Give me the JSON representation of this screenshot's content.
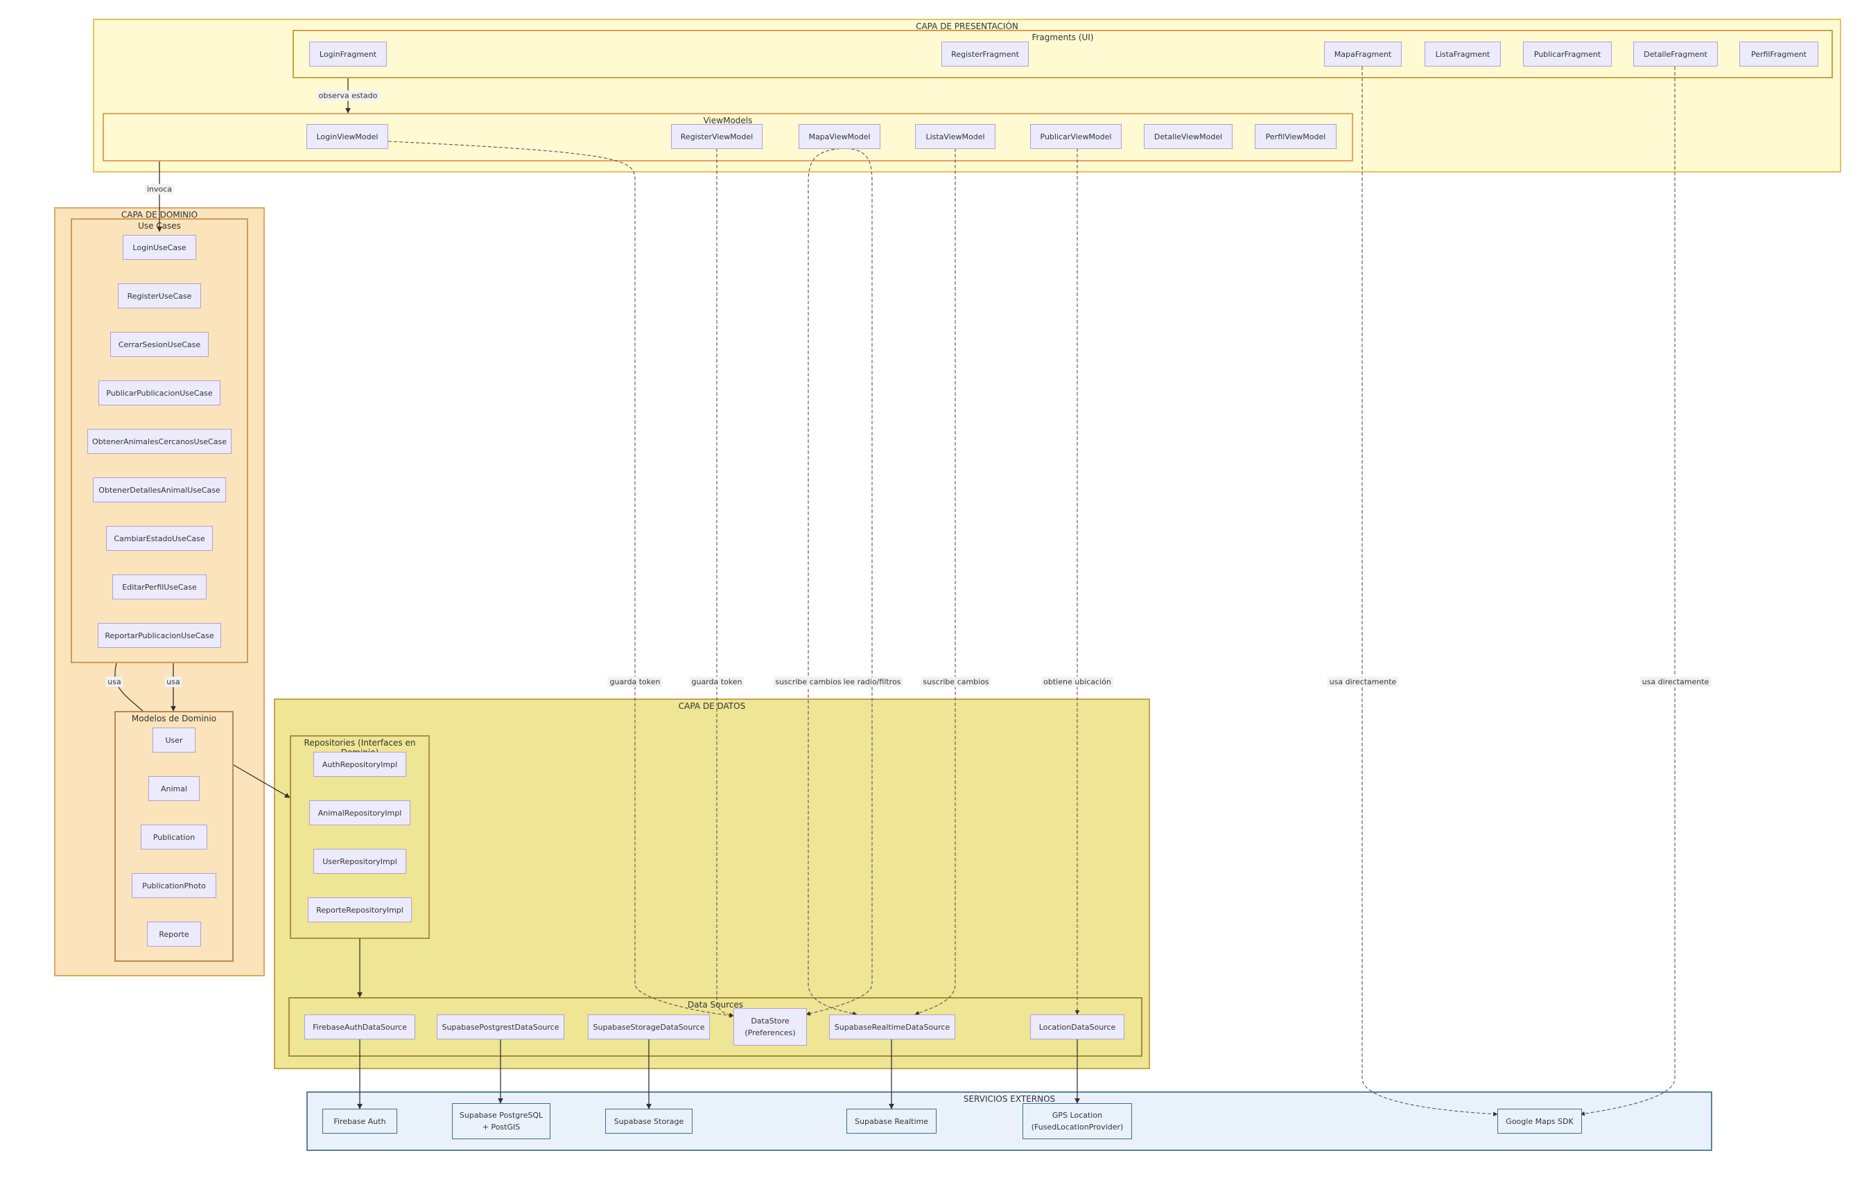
{
  "groups": {
    "presentacion": "CAPA DE PRESENTACIÓN",
    "fragments": "Fragments (UI)",
    "viewmodels": "ViewModels",
    "dominio": "CAPA DE DOMINIO",
    "usecases": "Use Cases",
    "modelos": "Modelos de Dominio",
    "datos": "CAPA DE DATOS",
    "repos": "Repositories (Interfaces en Dominio)",
    "datasources": "Data Sources",
    "externos": "SERVICIOS EXTERNOS"
  },
  "fragments": [
    "LoginFragment",
    "RegisterFragment",
    "MapaFragment",
    "ListaFragment",
    "PublicarFragment",
    "DetalleFragment",
    "PerfilFragment"
  ],
  "viewmodels": [
    "LoginViewModel",
    "RegisterViewModel",
    "MapaViewModel",
    "ListaViewModel",
    "PublicarViewModel",
    "DetalleViewModel",
    "PerfilViewModel"
  ],
  "usecases": [
    "LoginUseCase",
    "RegisterUseCase",
    "CerrarSesionUseCase",
    "PublicarPublicacionUseCase",
    "ObtenerAnimalesCercanosUseCase",
    "ObtenerDetallesAnimalUseCase",
    "CambiarEstadoUseCase",
    "EditarPerfilUseCase",
    "ReportarPublicacionUseCase"
  ],
  "modelos": [
    "User",
    "Animal",
    "Publication",
    "PublicationPhoto",
    "Reporte"
  ],
  "repos": [
    "AuthRepositoryImpl",
    "AnimalRepositoryImpl",
    "UserRepositoryImpl",
    "ReporteRepositoryImpl"
  ],
  "datasources": [
    "FirebaseAuthDataSource",
    "SupabasePostgrestDataSource",
    "SupabaseStorageDataSource",
    "DataStore\n(Preferences)",
    "SupabaseRealtimeDataSource",
    "LocationDataSource"
  ],
  "externos": [
    "Firebase Auth",
    "Supabase PostgreSQL\n+ PostGIS",
    "Supabase Storage",
    "Supabase Realtime",
    "GPS Location\n(FusedLocationProvider)",
    "Google Maps SDK"
  ],
  "edge_labels": {
    "observa": "observa estado",
    "invoca": "invoca",
    "usa1": "usa",
    "usa2": "usa",
    "guarda1": "guarda token",
    "guarda2": "guarda token",
    "suscribe1": "suscribe cambios",
    "lee": "lee radio/filtros",
    "suscribe2": "suscribe cambios",
    "ubicacion": "obtiene ubicación",
    "directo1": "usa directamente",
    "directo2": "usa directamente"
  },
  "colors": {
    "presentacion": "#fffad2",
    "dominio": "#fbe3bc",
    "datos": "#eee595",
    "externos": "#e9f2fb",
    "node": "#ecebfb",
    "node_border": "#b19fd9",
    "edge": "#333333"
  }
}
